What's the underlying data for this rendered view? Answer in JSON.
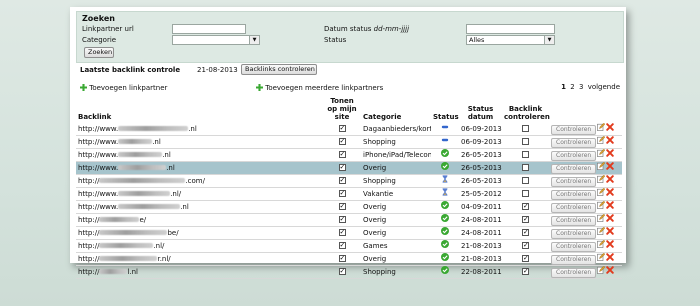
{
  "search": {
    "title": "Zoeken",
    "linkpartner_label": "Linkpartner url",
    "linkpartner_value": "",
    "categorie_label": "Categorie",
    "categorie_value": "",
    "datum_label": "Datum status",
    "datum_format": "dd-mm-jjjj",
    "datum_value": "",
    "status_label": "Status",
    "status_value": "Alles",
    "zoeken_button": "Zoeken"
  },
  "last_check": {
    "label": "Laatste backlink controle",
    "date": "21-08-2013",
    "button": "Backlinks controleren"
  },
  "actions": {
    "add_partner": "Toevoegen linkpartner",
    "add_multiple": "Toevoegen meerdere linkpartners"
  },
  "pager": {
    "current": "1",
    "pages": [
      "2",
      "3"
    ],
    "next": "volgende"
  },
  "table": {
    "headers": {
      "backlink": "Backlink",
      "tonen": "Tonen op mijn site",
      "categorie": "Categorie",
      "status": "Status",
      "status_datum": "Status datum",
      "backlink_controleren": "Backlink controleren"
    },
    "control_button": "Controleren",
    "rows": [
      {
        "prefix": "http://www.",
        "blur_w": 70,
        "suffix": ".nl",
        "categorie": "Dagaanbieders/kortir",
        "status": "blue-dash",
        "date": "06-09-2013",
        "controleren": false,
        "selected": false
      },
      {
        "prefix": "http://www.",
        "blur_w": 34,
        "suffix": ".nl",
        "categorie": "Shopping",
        "status": "blue-dash",
        "date": "06-09-2013",
        "controleren": false,
        "selected": false
      },
      {
        "prefix": "http://www.",
        "blur_w": 44,
        "suffix": ".nl",
        "categorie": "iPhone/iPad/Telecom",
        "status": "green-check",
        "date": "26-05-2013",
        "controleren": false,
        "selected": false
      },
      {
        "prefix": "http://www.",
        "blur_w": 48,
        "suffix": ".nl",
        "categorie": "Overig",
        "status": "green-check",
        "date": "26-05-2013",
        "controleren": false,
        "selected": true
      },
      {
        "prefix": "http://",
        "blur_w": 86,
        "suffix": ".com/",
        "categorie": "Shopping",
        "status": "hourglass",
        "date": "26-05-2013",
        "controleren": false,
        "selected": false
      },
      {
        "prefix": "http://www.",
        "blur_w": 52,
        "suffix": ".nl/",
        "categorie": "Vakantie",
        "status": "hourglass",
        "date": "25-05-2012",
        "controleren": false,
        "selected": false
      },
      {
        "prefix": "http://www.",
        "blur_w": 62,
        "suffix": ".nl",
        "categorie": "Overig",
        "status": "green-check",
        "date": "04-09-2011",
        "controleren": true,
        "selected": false
      },
      {
        "prefix": "http://",
        "blur_w": 40,
        "suffix": "e/",
        "categorie": "Overig",
        "status": "green-check",
        "date": "24-08-2011",
        "controleren": true,
        "selected": false
      },
      {
        "prefix": "http://",
        "blur_w": 68,
        "suffix": "be/",
        "categorie": "Overig",
        "status": "green-check",
        "date": "24-08-2011",
        "controleren": true,
        "selected": false
      },
      {
        "prefix": "http://",
        "blur_w": 54,
        "suffix": ".nl/",
        "categorie": "Games",
        "status": "green-check",
        "date": "21-08-2013",
        "controleren": true,
        "selected": false
      },
      {
        "prefix": "http://",
        "blur_w": 58,
        "suffix": "r.nl/",
        "categorie": "Overig",
        "status": "green-check",
        "date": "21-08-2013",
        "controleren": true,
        "selected": false
      },
      {
        "prefix": "http://",
        "blur_w": 28,
        "suffix": "l.nl",
        "categorie": "Shopping",
        "status": "green-check",
        "date": "22-08-2011",
        "controleren": true,
        "selected": false
      }
    ]
  },
  "colors": {
    "panel": "#dde9e3",
    "selected_row": "#a6c4cc",
    "status_ok": "#3aa832",
    "status_pending": "#3366cc"
  }
}
